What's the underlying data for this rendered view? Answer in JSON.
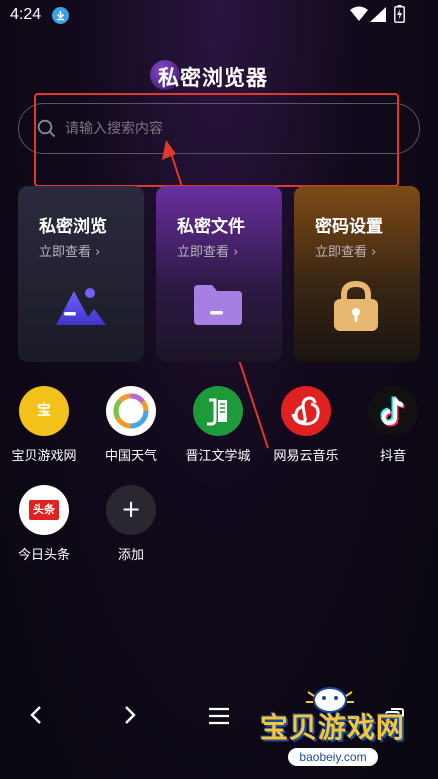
{
  "status_bar": {
    "time": "4:24",
    "icons": [
      "download-notification-icon",
      "wifi-icon",
      "signal-icon",
      "battery-charging-icon"
    ]
  },
  "header": {
    "title": "私密浏览器"
  },
  "search": {
    "placeholder": "请输入搜索内容",
    "value": ""
  },
  "cards": [
    {
      "title": "私密浏览",
      "subtitle": "立即查看 ›",
      "icon": "mountain-icon"
    },
    {
      "title": "私密文件",
      "subtitle": "立即查看 ›",
      "icon": "folder-icon"
    },
    {
      "title": "密码设置",
      "subtitle": "立即查看 ›",
      "icon": "lock-icon"
    }
  ],
  "shortcuts": [
    {
      "label": "宝贝游戏网",
      "icon_text": "宝",
      "icon": "baobei-icon",
      "color": "#f2c21a"
    },
    {
      "label": "中国天气",
      "icon": "china-weather-icon",
      "color": "#ffffff"
    },
    {
      "label": "晋江文学城",
      "icon": "jinjiang-icon",
      "color": "#1e9a3a"
    },
    {
      "label": "网易云音乐",
      "icon": "netease-music-icon",
      "color": "#e0211f"
    },
    {
      "label": "抖音",
      "icon": "douyin-icon",
      "color": "#111111"
    },
    {
      "label": "今日头条",
      "icon_text": "头条",
      "icon": "toutiao-icon",
      "color": "#ffffff"
    },
    {
      "label": "添加",
      "icon_text": "+",
      "icon": "add-icon",
      "color": "#2a2730"
    }
  ],
  "bottom_nav": [
    "back-icon",
    "forward-icon",
    "menu-icon",
    "tabs-icon"
  ],
  "watermark": {
    "text": "宝贝游戏网",
    "url": "baobeiy.com"
  },
  "colors": {
    "accent": "#e0382c",
    "background": "#120a1c"
  }
}
